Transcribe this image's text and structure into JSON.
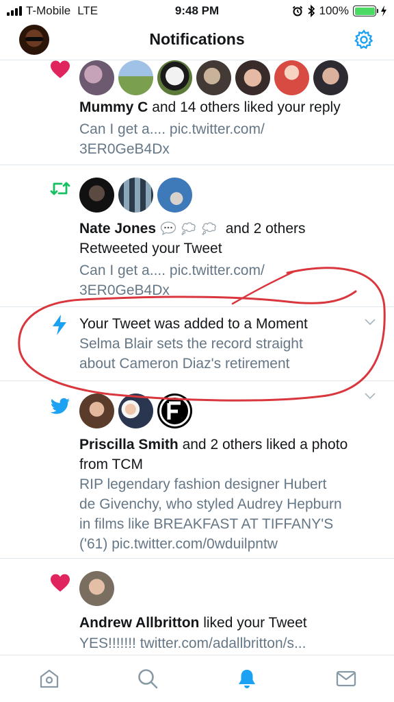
{
  "status_bar": {
    "carrier": "T-Mobile",
    "network": "LTE",
    "time": "9:48 PM",
    "battery_percent": "100%",
    "icons": [
      "signal-icon",
      "alarm-icon",
      "bluetooth-icon",
      "battery-icon",
      "charging-icon"
    ]
  },
  "header": {
    "title": "Notifications",
    "settings_icon": "gear-icon"
  },
  "notifications": [
    {
      "type": "like",
      "icon": "heart-icon",
      "actor": "Mummy C",
      "text": "and 14 others liked your reply",
      "preview_line1": "Can I get a.... pic.twitter.com/",
      "preview_line2": "3ER0GeB4Dx"
    },
    {
      "type": "retweet",
      "icon": "retweet-icon",
      "actor": "Nate Jones",
      "text_a": "and 2 others",
      "text_b": "Retweeted your Tweet",
      "preview_line1": "Can I get a.... pic.twitter.com/",
      "preview_line2": "3ER0GeB4Dx"
    },
    {
      "type": "moment",
      "icon": "lightning-icon",
      "text": "Your Tweet was added to a Moment",
      "preview_line1": "Selma Blair sets the record straight",
      "preview_line2": "about Cameron Diaz's retirement"
    },
    {
      "type": "like-photo",
      "icon": "twitter-bird-icon",
      "actor": "Priscilla Smith",
      "text_a": "and 2 others liked a photo",
      "text_b": "from TCM",
      "preview_line1": "RIP legendary fashion designer Hubert",
      "preview_line2": "de Givenchy, who styled Audrey Hepburn",
      "preview_line3": "in films like BREAKFAST AT TIFFANY'S",
      "preview_line4": "('61) pic.twitter.com/0wduilpntw"
    },
    {
      "type": "like",
      "icon": "heart-icon",
      "actor": "Andrew Allbritton",
      "text": "liked your Tweet",
      "preview_line1": "YES!!!!!!! twitter.com/adallbritton/s..."
    }
  ],
  "tab_bar": {
    "tabs": [
      "home-icon",
      "search-icon",
      "notifications-icon",
      "messages-icon"
    ],
    "active": "notifications-icon"
  },
  "colors": {
    "twitter_blue": "#1da1f2",
    "like_red": "#e0245e",
    "retweet_green": "#17bf63",
    "secondary_text": "#657786",
    "divider": "#e1e8ed",
    "annotation_red": "#d9363e",
    "battery_green": "#4cd964"
  }
}
